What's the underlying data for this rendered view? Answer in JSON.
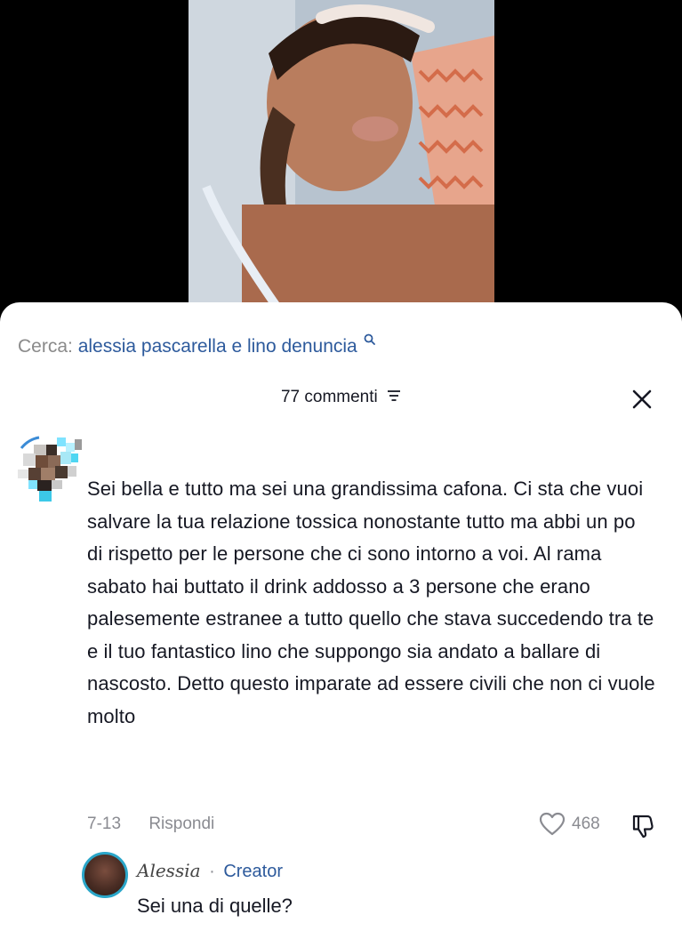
{
  "video": {
    "thumbnail_icon": "video-frame-photo"
  },
  "search": {
    "prefix": "Cerca:",
    "query": "alessia pascarella e lino denuncia",
    "icon": "search-icon"
  },
  "comments_header": {
    "count_label": "77 commenti",
    "sort_icon": "sort-icon",
    "close_icon": "close-icon"
  },
  "comment": {
    "avatar_icon": "pixelated-avatar",
    "text": "Sei bella e tutto ma sei una grandissima cafona. Ci sta che vuoi salvare la tua relazione tossica nonostante tutto ma abbi un po di rispetto per le persone che ci sono intorno a voi. Al rama sabato hai buttato il drink addosso a 3 persone che erano palesemente estranee a tutto quello che stava succedendo tra te e il tuo fantastico lino che suppongo sia andato a ballare di nascosto. Detto questo imparate ad essere civili che non ci vuole molto",
    "date": "7-13",
    "reply_label": "Rispondi",
    "likes": "468",
    "like_icon": "heart-icon",
    "dislike_icon": "dislike-icon"
  },
  "reply": {
    "author": "Alessia",
    "separator": "·",
    "badge": "Creator",
    "text": "Sei una di quelle?"
  },
  "colors": {
    "accent": "#2d5a9c",
    "avatar_ring": "#2aa6c9",
    "muted": "#8a8b91",
    "text": "#161823"
  }
}
